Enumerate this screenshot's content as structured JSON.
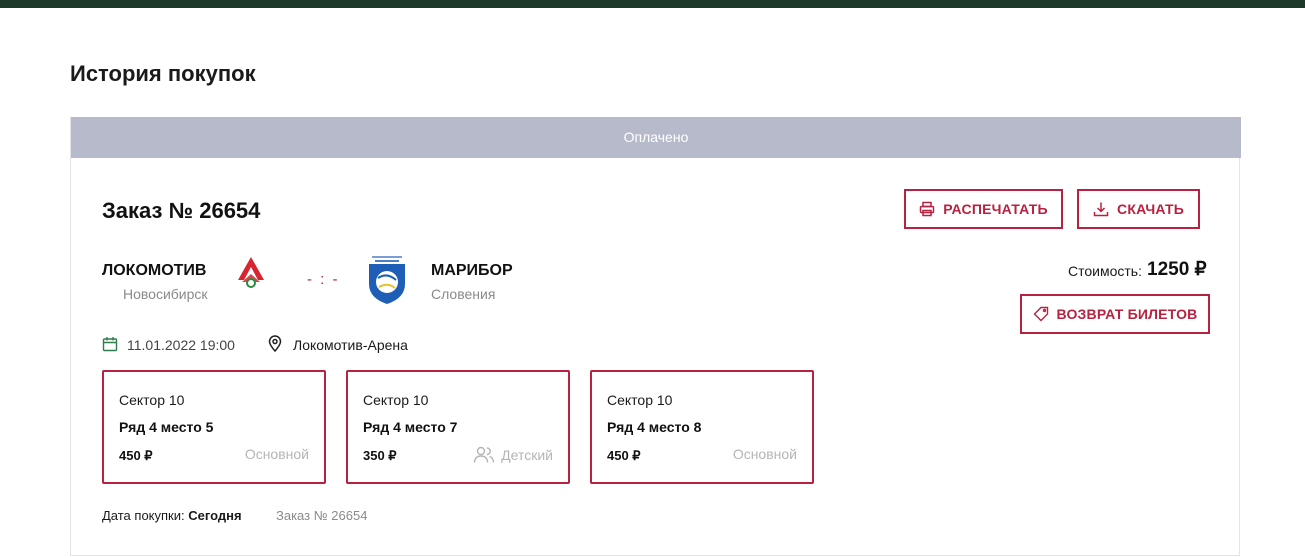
{
  "page": {
    "title": "История покупок"
  },
  "order": {
    "status": "Оплачено",
    "number_label": "Заказ № 26654",
    "actions": {
      "print": "РАСПЕЧАТАТЬ",
      "download": "СКАЧАТЬ",
      "refund": "ВОЗВРАТ БИЛЕТОВ"
    },
    "match": {
      "home": {
        "name": "ЛОКОМОТИВ",
        "city": "Новосибирск",
        "logo_icon": "lokomotiv-logo",
        "logo_color": "#d8242f"
      },
      "separator": "- : -",
      "away": {
        "name": "МАРИБОР",
        "city": "Словения",
        "logo_icon": "maribor-logo",
        "logo_color": "#1f5eb6"
      }
    },
    "cost": {
      "label": "Стоимость:",
      "value": "1250 ₽"
    },
    "datetime": "11.01.2022 19:00",
    "venue": "Локомотив-Арена",
    "tickets": [
      {
        "sector": "Сектор 10",
        "seat": "Ряд 4 место 5",
        "price": "450 ₽",
        "type": "Основной",
        "type_icon": ""
      },
      {
        "sector": "Сектор 10",
        "seat": "Ряд 4 место 7",
        "price": "350 ₽",
        "type": "Детский",
        "type_icon": "users-icon"
      },
      {
        "sector": "Сектор 10",
        "seat": "Ряд 4 место 8",
        "price": "450 ₽",
        "type": "Основной",
        "type_icon": ""
      }
    ],
    "purchase": {
      "label": "Дата покупки:",
      "value": "Сегодня",
      "order_ref": "Заказ № 26654"
    }
  },
  "colors": {
    "accent": "#b8213f",
    "header_bar": "#1d3a28",
    "status_banner": "#b7bacb",
    "muted_text": "#8a8a8a",
    "date_icon": "#2e7d4f"
  }
}
